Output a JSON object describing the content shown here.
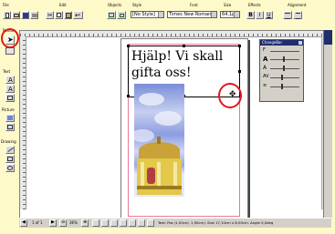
{
  "colors": {
    "background": "#fef9c9",
    "toolbar": "#d4d0c8",
    "workspace": "#ffffff",
    "dark_panel": "#202e6e",
    "red_highlight": "#e0161f"
  },
  "toolbar": {
    "groups": {
      "file": "File",
      "edit": "Edit",
      "objects": "Objects",
      "style": "Style",
      "font": "Font",
      "size": "Size",
      "effects": "Effects",
      "alignment": "Alignment"
    },
    "style_value": "[No Style]",
    "font_value": "Times New Roman",
    "size_value": "64,1p",
    "bold": "B",
    "italic": "I",
    "underline": "U"
  },
  "toolbox": {
    "pointer": "Pointer",
    "text": "Text",
    "picture": "Picture",
    "drawing": "Drawing"
  },
  "document": {
    "heading_line1": "Hjälp! Vi skall",
    "heading_line2": "gifta oss!"
  },
  "change_bar": {
    "title": "ChangeBar"
  },
  "status": {
    "page": "1 of 1",
    "zoom": "36%",
    "info": "Text: Pos (1,00cm, 1,90cm). Size 17,10cm x 8,00cm. Angle 0,0deg"
  },
  "icons": [
    "new-icon",
    "open-icon",
    "save-icon",
    "print-icon",
    "cut-icon",
    "copy-icon",
    "paste-icon",
    "undo-icon",
    "group-icon",
    "ungroup-icon",
    "arrow-pointer-icon",
    "text-frame-icon",
    "picture-frame-icon",
    "line-icon",
    "rectangle-icon",
    "ellipse-icon",
    "move-cursor-icon",
    "align-left-icon",
    "align-center-icon"
  ]
}
